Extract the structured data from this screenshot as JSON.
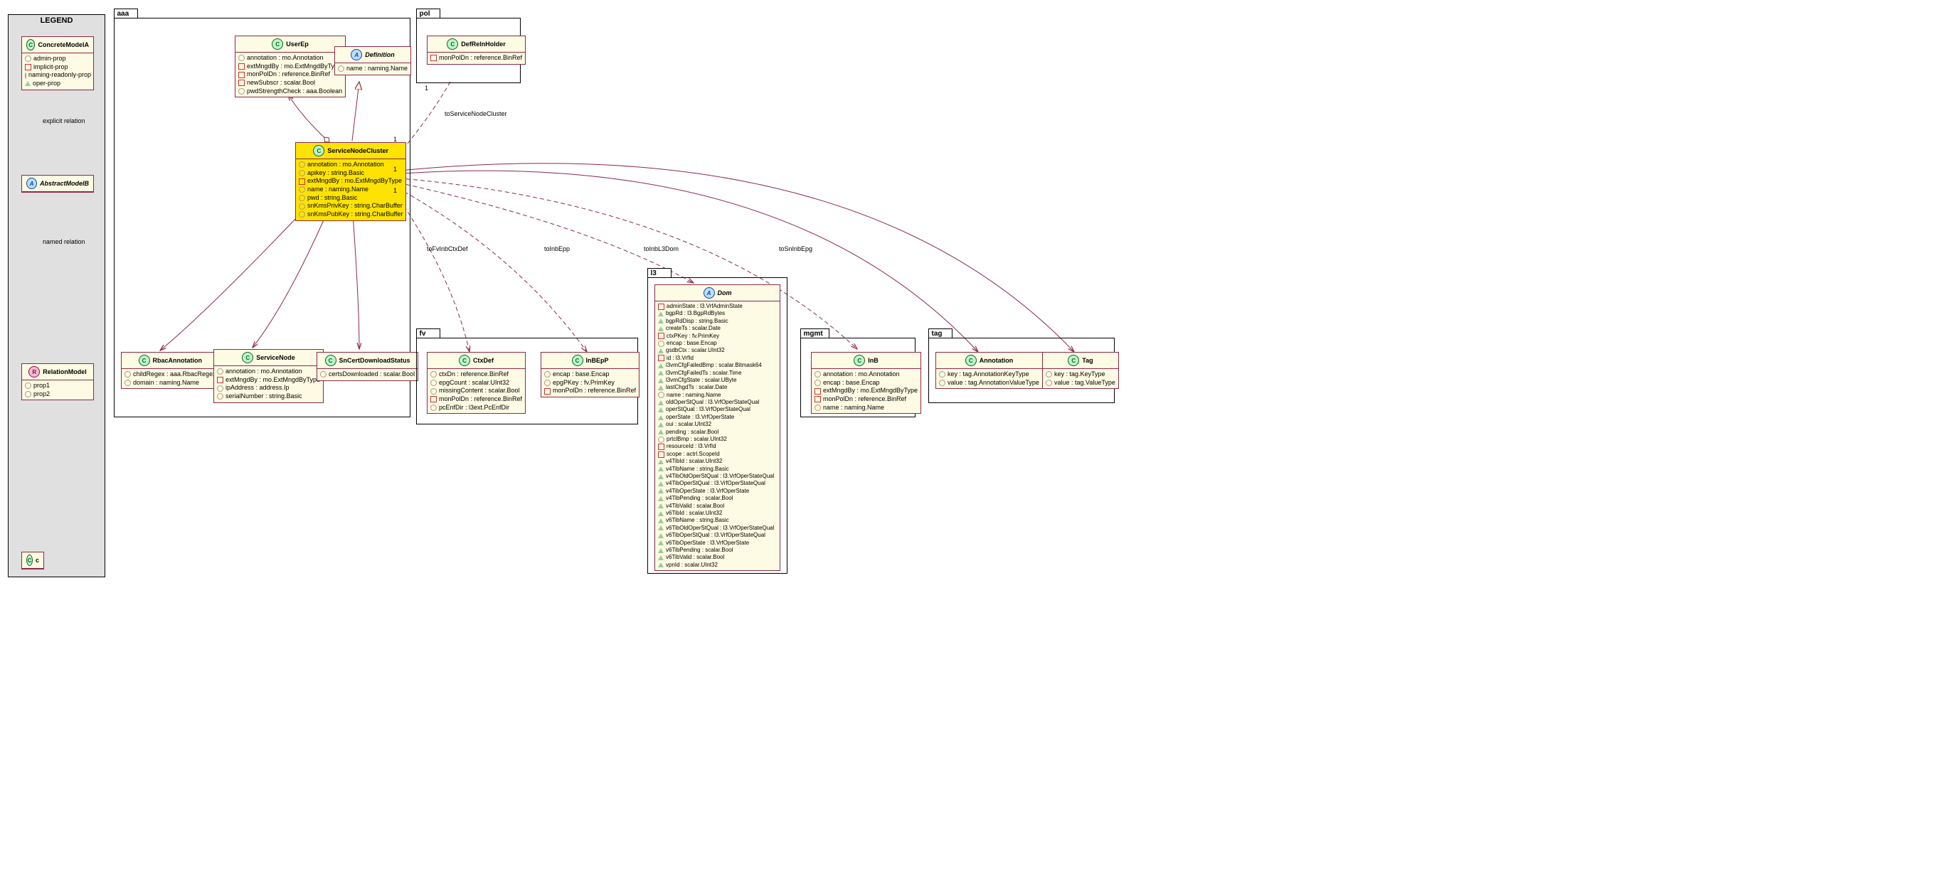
{
  "legend": {
    "title": "LEGEND",
    "modelA": {
      "name": "ConcreteModelA",
      "props": [
        "admin-prop",
        "implicit-prop",
        "naming-readonly-prop",
        "oper-prop"
      ]
    },
    "modelB": {
      "name": "AbstractModelB"
    },
    "relModel": {
      "name": "RelationModel",
      "props": [
        "prop1",
        "prop2"
      ]
    },
    "c": {
      "name": "c"
    },
    "explicit": "explicit relation",
    "named": "named relation"
  },
  "pkg": {
    "aaa": "aaa",
    "pol": "pol",
    "fv": "fv",
    "l3": "l3",
    "mgmt": "mgmt",
    "tag": "tag"
  },
  "aaa": {
    "userEp": {
      "name": "UserEp",
      "props": [
        "annotation : mo.Annotation",
        "extMngdBy : mo.ExtMngdByType",
        "monPolDn : reference.BinRef",
        "newSubscr : scalar.Bool",
        "pwdStrengthCheck : aaa.Boolean"
      ]
    },
    "definition": {
      "name": "Definition",
      "props": [
        "name : naming.Name"
      ]
    },
    "snc": {
      "name": "ServiceNodeCluster",
      "props": [
        "annotation : mo.Annotation",
        "apikey : string.Basic",
        "extMngdBy : mo.ExtMngdByType",
        "name : naming.Name",
        "pwd : string.Basic",
        "snKmsPrivKey : string.CharBuffer",
        "snKmsPubKey : string.CharBuffer"
      ]
    },
    "rbac": {
      "name": "RbacAnnotation",
      "props": [
        "childRegex : aaa.RbacRegex",
        "domain : naming.Name"
      ]
    },
    "sn": {
      "name": "ServiceNode",
      "props": [
        "annotation : mo.Annotation",
        "extMngdBy : mo.ExtMngdByType",
        "ipAddress : address.Ip",
        "serialNumber : string.Basic"
      ]
    },
    "scds": {
      "name": "SnCertDownloadStatus",
      "props": [
        "certsDownloaded : scalar.Bool"
      ]
    }
  },
  "pol": {
    "drh": {
      "name": "DefRelnHolder",
      "props": [
        "monPolDn : reference.BinRef"
      ]
    }
  },
  "fv": {
    "ctxdef": {
      "name": "CtxDef",
      "props": [
        "ctxDn : reference.BinRef",
        "epgCount : scalar.UInt32",
        "missingContent : scalar.Bool",
        "monPolDn : reference.BinRef",
        "pcEnfDir : l3ext.PcEnfDir"
      ]
    },
    "inbepp": {
      "name": "InBEpP",
      "props": [
        "encap : base.Encap",
        "epgPKey : fv.PrimKey",
        "monPolDn : reference.BinRef"
      ]
    }
  },
  "l3": {
    "dom": {
      "name": "Dom",
      "props": [
        "adminState : l3.VrfAdminState",
        "bgpRd : l3.BgpRdBytes",
        "bgpRdDisp : string.Basic",
        "createTs : scalar.Date",
        "ctxPKey : fv.PrimKey",
        "encap : base.Encap",
        "gsdbCtx : scalar.UInt32",
        "id : l3.VrfId",
        "l3vmCfgFailedBmp : scalar.Bitmask64",
        "l3vmCfgFailedTs : scalar.Time",
        "l3vmCfgState : scalar.UByte",
        "lastChgdTs : scalar.Date",
        "name : naming.Name",
        "oldOperStQual : l3.VrfOperStateQual",
        "operStQual : l3.VrfOperStateQual",
        "operState : l3.VrfOperState",
        "oui : scalar.UInt32",
        "pending : scalar.Bool",
        "prtclBmp : scalar.UInt32",
        "resourceId : l3.VrfId",
        "scope : actrl.ScopeId",
        "v4TibId : scalar.UInt32",
        "v4TibName : string.Basic",
        "v4TibOldOperStQual : l3.VrfOperStateQual",
        "v4TibOperStQual : l3.VrfOperStateQual",
        "v4TibOperState : l3.VrfOperState",
        "v4TibPending : scalar.Bool",
        "v4TibValid : scalar.Bool",
        "v6TibId : scalar.UInt32",
        "v6TibName : string.Basic",
        "v6TibOldOperStQual : l3.VrfOperStateQual",
        "v6TibOperStQual : l3.VrfOperStateQual",
        "v6TibOperState : l3.VrfOperState",
        "v6TibPending : scalar.Bool",
        "v6TibValid : scalar.Bool",
        "vpnId : scalar.UInt32"
      ]
    }
  },
  "mgmt": {
    "inb": {
      "name": "InB",
      "props": [
        "annotation : mo.Annotation",
        "encap : base.Encap",
        "extMngdBy : mo.ExtMngdByType",
        "monPolDn : reference.BinRef",
        "name : naming.Name"
      ]
    }
  },
  "tag": {
    "ann": {
      "name": "Annotation",
      "props": [
        "key : tag.AnnotationKeyType",
        "value : tag.AnnotationValueType"
      ]
    },
    "tag": {
      "name": "Tag",
      "props": [
        "key : tag.KeyType",
        "value : tag.ValueType"
      ]
    }
  },
  "rel": {
    "toSNC": "toServiceNodeCluster",
    "toFvInbCtxDef": "toFvInbCtxDef",
    "toInbEpp": "toInbEpp",
    "toInbL3Dom": "toInbL3Dom",
    "toSnInbEpg": "toSnInbEpg"
  },
  "chart_data": null
}
